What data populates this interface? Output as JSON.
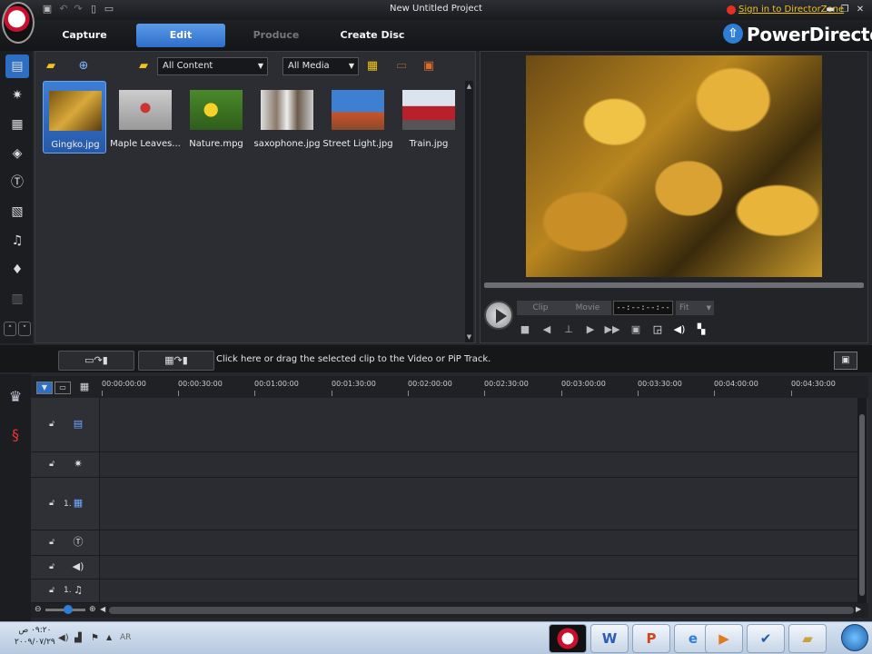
{
  "window": {
    "title": "New Untitled Project",
    "signin_link": "Sign in to DirectorZone",
    "brand": "PowerDirector"
  },
  "mode_tabs": [
    {
      "label": "Capture",
      "state": "normal"
    },
    {
      "label": "Edit",
      "state": "active"
    },
    {
      "label": "Produce",
      "state": "disabled"
    },
    {
      "label": "Create Disc",
      "state": "normal"
    }
  ],
  "library": {
    "content_filter": "All Content",
    "media_filter": "All Media",
    "items": [
      {
        "label": "Gingko.jpg",
        "selected": true
      },
      {
        "label": "Maple Leaves...",
        "selected": false
      },
      {
        "label": "Nature.mpg",
        "selected": false
      },
      {
        "label": "saxophone.jpg",
        "selected": false
      },
      {
        "label": "Street Light.jpg",
        "selected": false
      },
      {
        "label": "Train.jpg",
        "selected": false
      }
    ]
  },
  "preview": {
    "clip_label": "Clip",
    "movie_label": "Movie",
    "timecode": "--:--:--:--",
    "fit_label": "Fit"
  },
  "timeline": {
    "hint": "Click here or drag the selected clip to the Video or PiP Track.",
    "ruler": [
      "00:00:00:00",
      "00:00:30:00",
      "00:01:00:00",
      "00:01:30:00",
      "00:02:00:00",
      "00:02:30:00",
      "00:03:00:00",
      "00:03:30:00",
      "00:04:00:00",
      "00:04:30:00"
    ],
    "tracks": [
      {
        "name": "video-track",
        "num": ""
      },
      {
        "name": "effect-track",
        "num": ""
      },
      {
        "name": "pip-track",
        "num": "1."
      },
      {
        "name": "title-track",
        "num": ""
      },
      {
        "name": "voice-track",
        "num": ""
      },
      {
        "name": "music-track",
        "num": "1."
      }
    ]
  },
  "taskbar": {
    "time": "٠٩:٢٠ ص",
    "date": "٢٠٠٩/٠٧/٢٩",
    "lang": "AR"
  }
}
